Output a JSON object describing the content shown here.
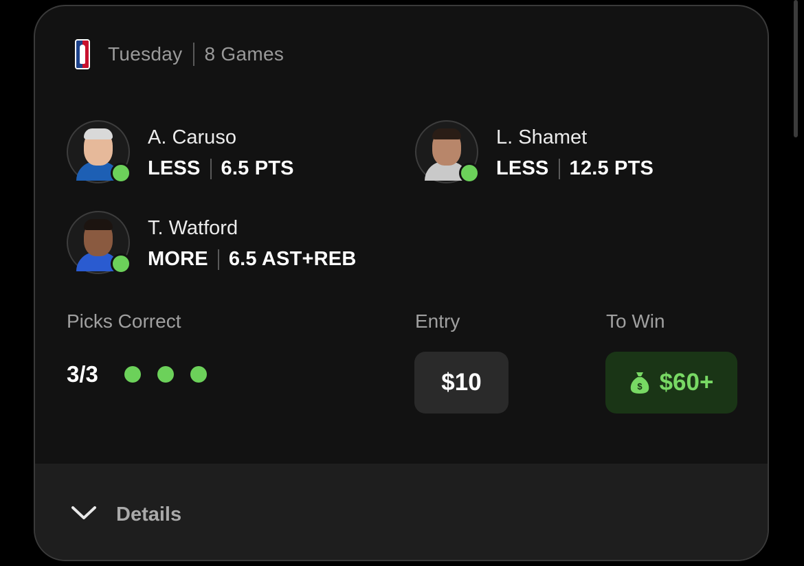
{
  "header": {
    "league_icon": "nba-logo",
    "day": "Tuesday",
    "games": "8 Games"
  },
  "picks": [
    {
      "player": "A. Caruso",
      "direction": "LESS",
      "line": "6.5 PTS",
      "status": "hit",
      "jersey_color": "#1d5fb4",
      "skin": "#e6b99a",
      "hair_color": "#d9d9d9"
    },
    {
      "player": "L. Shamet",
      "direction": "LESS",
      "line": "12.5 PTS",
      "status": "hit",
      "jersey_color": "#c9c9c9",
      "skin": "#b8866a",
      "hair_color": "#2a1d16"
    },
    {
      "player": "T. Watford",
      "direction": "MORE",
      "line": "6.5 AST+REB",
      "status": "hit",
      "jersey_color": "#2a5bd0",
      "skin": "#8a5a40",
      "hair_color": "#1c1410"
    }
  ],
  "summary": {
    "picks_label": "Picks Correct",
    "picks_value": "3/3",
    "picks_correct_count": 3,
    "entry_label": "Entry",
    "entry_value": "$10",
    "to_win_label": "To Win",
    "to_win_value": "$60+",
    "to_win_icon": "money-bag-icon"
  },
  "details": {
    "label": "Details",
    "icon": "chevron-down-icon"
  },
  "colors": {
    "success": "#6cd15a",
    "win_bg": "#1a3516",
    "card_bg": "#121212"
  }
}
